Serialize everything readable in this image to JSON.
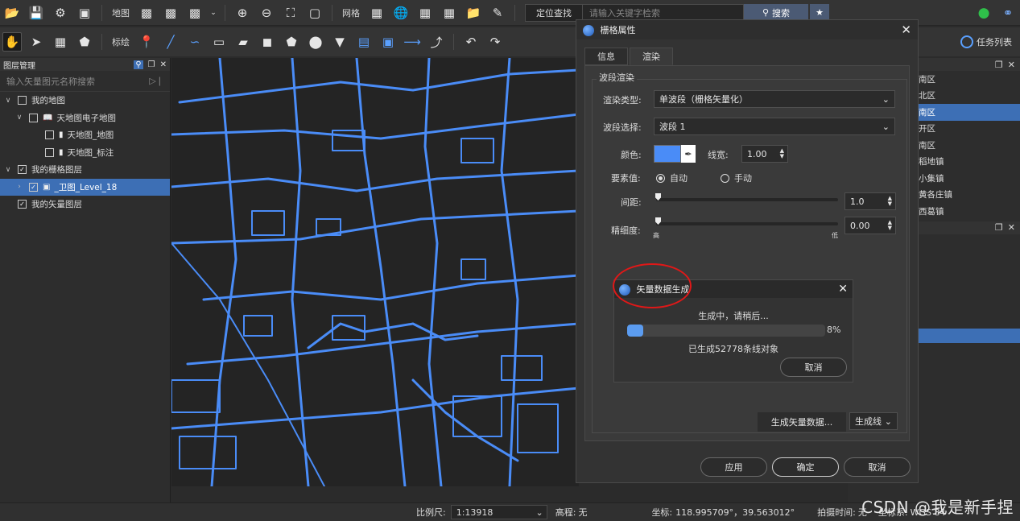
{
  "toolbar1": {
    "map_label": "地图",
    "grid_label": "网格",
    "locate_label": "定位查找",
    "search_placeholder": "请输入关键字检索",
    "search_label": "搜索",
    "task_list_label": "任务列表"
  },
  "toolbar2": {
    "label_tool": "标绘"
  },
  "layers_panel": {
    "title": "图层管理",
    "search_placeholder": "输入矢量图元名称搜索",
    "items": [
      {
        "label": "我的地图"
      },
      {
        "label": "天地图电子地图"
      },
      {
        "label": "天地图_地图"
      },
      {
        "label": "天地图_标注"
      },
      {
        "label": "我的栅格图层"
      },
      {
        "label": "_卫图_Level_18"
      },
      {
        "label": "我的矢量图层"
      }
    ]
  },
  "right_panel": {
    "rows": [
      "南区",
      "北区",
      "南区",
      "开区",
      "南区",
      "稻地镇",
      "小集镇",
      "黄各庄镇",
      "西葛镇"
    ]
  },
  "raster_dialog": {
    "title": "栅格属性",
    "tabs": [
      {
        "label": "信息"
      },
      {
        "label": "渲染"
      }
    ],
    "section_title": "波段渲染",
    "render_type_label": "渲染类型:",
    "render_type_value": "单波段（栅格矢量化）",
    "band_label": "波段选择:",
    "band_value": "波段 1",
    "color_label": "颜色:",
    "color_value": "#4a8cf7",
    "line_width_label": "线宽:",
    "line_width_value": "1.00",
    "feature_label": "要素值:",
    "auto_label": "自动",
    "manual_label": "手动",
    "spacing_label": "间距:",
    "spacing_value": "1.0",
    "fineness_label": "精细度:",
    "fineness_value": "0.00",
    "high_label": "高",
    "low_label": "低",
    "generate_btn": "生成矢量数据...",
    "generate_type": "生成线",
    "apply_btn": "应用",
    "ok_btn": "确定",
    "cancel_btn": "取消"
  },
  "progress_dialog": {
    "title": "矢量数据生成",
    "status": "生成中，请稍后...",
    "percent_text": "8%",
    "progress": 0.08,
    "count_text": "已生成52778条线对象",
    "cancel_btn": "取消"
  },
  "status_bar": {
    "scale_label": "比例尺:",
    "scale_value": "1:13918",
    "elevation_label": "高程:",
    "elevation_value": "无",
    "coord_label": "坐标:",
    "coord_value": "118.995709°，39.563012°",
    "capture_label": "拍摄时间:",
    "capture_value": "无",
    "crs_label": "坐标系:",
    "crs_value": "WGS 84"
  },
  "watermark": "CSDN @我是新手捏",
  "colors": {
    "accent": "#3d6fb5",
    "road": "#4a8cf7",
    "highlight_circle": "#e01818"
  }
}
